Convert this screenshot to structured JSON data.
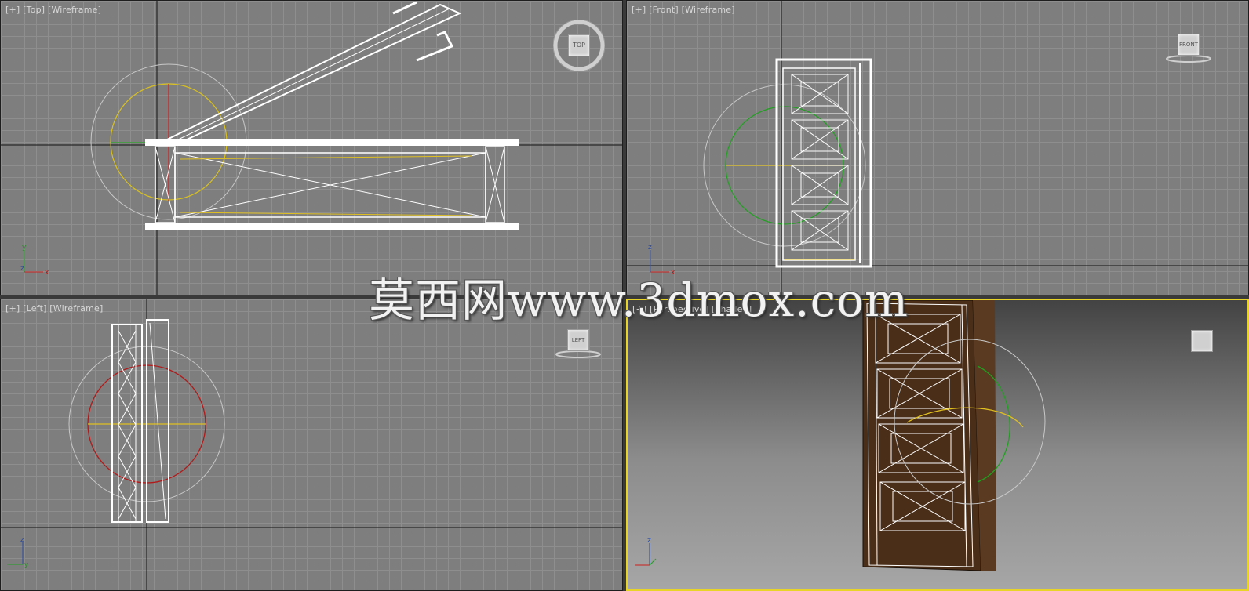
{
  "viewports": {
    "top": {
      "bracket_plus": "[+]",
      "view": "[Top]",
      "shading": "[Wireframe]",
      "cube_face": "TOP"
    },
    "front": {
      "bracket_plus": "[+]",
      "view": "[Front]",
      "shading": "[Wireframe]",
      "cube_face": "FRONT"
    },
    "left": {
      "bracket_plus": "[+]",
      "view": "[Left]",
      "shading": "[Wireframe]",
      "cube_face": "LEFT"
    },
    "persp": {
      "bracket_plus": "[+]",
      "view": "[Perspective]",
      "shading": "[Shaded]",
      "cube_face": ""
    }
  },
  "axes": {
    "x": "x",
    "y": "y",
    "z": "z"
  },
  "watermark": "莫西网www.3dmox.com",
  "colors": {
    "active_border": "#e8d427",
    "gizmo_x": "#cc2020",
    "gizmo_y": "#20a020",
    "gizmo_z": "#e0c020",
    "wood": "#4a2e18"
  }
}
